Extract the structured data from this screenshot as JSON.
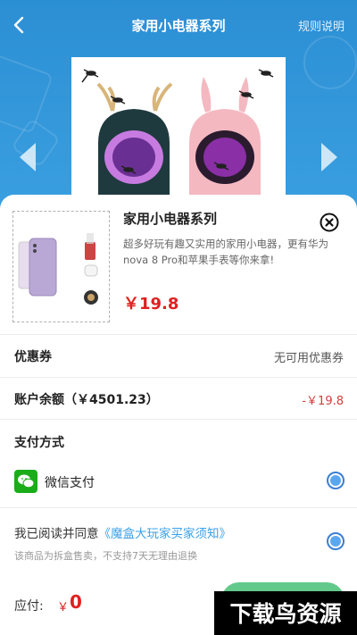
{
  "header": {
    "title": "家用小电器系列",
    "rules_label": "规则说明"
  },
  "product": {
    "name": "家用小电器系列",
    "description": "超多好玩有趣又实用的家用小电器，更有华为nova 8 Pro和苹果手表等你来拿!",
    "price": "￥19.8"
  },
  "coupon": {
    "label": "优惠券",
    "value": "无可用优惠券"
  },
  "balance": {
    "label": "账户余额（￥4501.23）",
    "deduction": "-￥19.8"
  },
  "payment": {
    "section_title": "支付方式",
    "method_label": "微信支付",
    "method_selected": true
  },
  "agreement": {
    "prefix": "我已阅读并同意",
    "link": "《魔盒大玩家买家须知》",
    "checked": true,
    "notice": "该商品为拆盒售卖，不支持7天无理由退换"
  },
  "footer": {
    "pay_label": "应付:",
    "currency": "￥",
    "amount": "0"
  },
  "watermark": {
    "text": "下载鸟资源"
  },
  "colors": {
    "header_bg": "#2f93d6",
    "price_red": "#e02020",
    "link_blue": "#3aa0e8",
    "wechat_green": "#1aad19",
    "pay_button_green": "#62c98a"
  },
  "icons": [
    "back-arrow-icon",
    "chevron-left-icon",
    "chevron-right-icon",
    "close-icon",
    "wechat-pay-icon"
  ]
}
